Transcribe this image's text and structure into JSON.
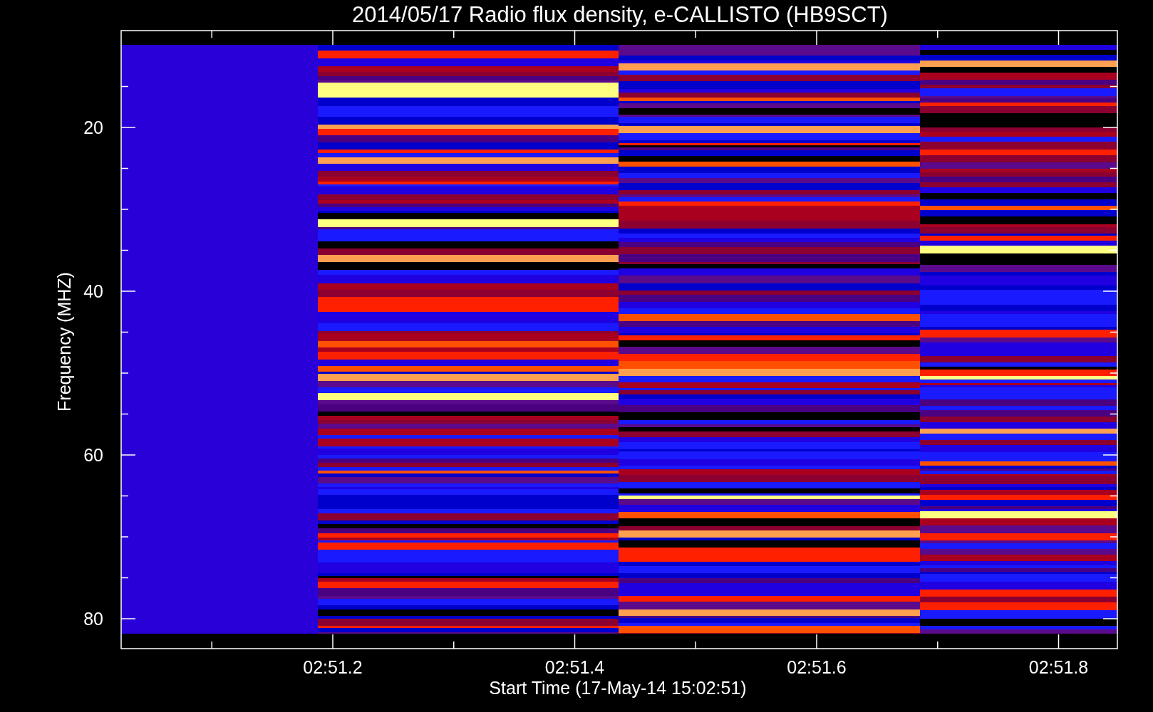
{
  "plot": {
    "title": "2014/05/17  Radio flux density, e-CALLISTO (HB9SCT)",
    "ylabel": "Frequency (MHZ)",
    "xlabel": "Start Time (17-May-14 15:02:51)",
    "yticks": [
      "20",
      "40",
      "60",
      "80"
    ],
    "xticks": [
      "02:51.2",
      "02:51.4",
      "02:51.6",
      "02:51.8"
    ]
  }
}
